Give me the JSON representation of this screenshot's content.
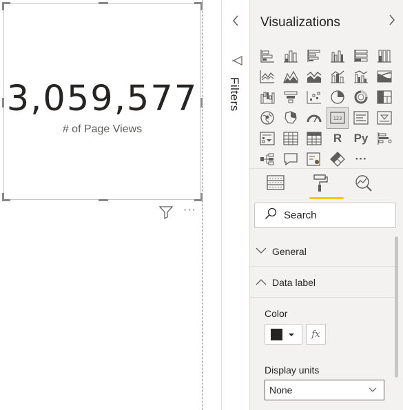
{
  "card": {
    "value": "3,059,577",
    "label": "# of Page Views"
  },
  "visual_header": {
    "filter_icon": "filter-funnel-icon",
    "more_options": "···"
  },
  "filters_pane": {
    "title": "Filters",
    "collapse_icon": "chevron-left-icon"
  },
  "visualizations_pane": {
    "title": "Visualizations",
    "expand_icon": "chevron-right-icon",
    "gallery_icons": [
      "stacked-bar-chart-icon",
      "stacked-column-chart-icon",
      "clustered-bar-chart-icon",
      "clustered-column-chart-icon",
      "100-stacked-bar-chart-icon",
      "100-stacked-column-chart-icon",
      "line-chart-icon",
      "area-chart-icon",
      "stacked-area-chart-icon",
      "line-and-stacked-column-chart-icon",
      "line-and-clustered-column-chart-icon",
      "ribbon-chart-icon",
      "waterfall-chart-icon",
      "funnel-chart-icon",
      "scatter-chart-icon",
      "pie-chart-icon",
      "donut-chart-icon",
      "treemap-icon",
      "map-icon",
      "filled-map-icon",
      "gauge-icon",
      "card-icon",
      "multi-row-card-icon",
      "kpi-icon",
      "slicer-icon",
      "table-icon",
      "matrix-icon",
      "r-visual-icon",
      "python-visual-icon",
      "key-influencers-icon",
      "decomposition-tree-icon",
      "qa-icon",
      "smart-narrative-icon",
      "power-apps-icon",
      "more-visuals-icon"
    ],
    "r_glyph": "R",
    "py_glyph": "Py",
    "more_glyph": "···",
    "tabs": [
      "fields-tab-icon",
      "format-paint-roller-icon",
      "analytics-icon"
    ],
    "accent_color": "#f2c811",
    "search": {
      "placeholder": "Search"
    },
    "sections": {
      "general": "General",
      "data_label": "Data label"
    },
    "data_label": {
      "color_label": "Color",
      "color_value": "#252423",
      "fx_label": "fx",
      "display_units_label": "Display units",
      "display_units_value": "None"
    }
  }
}
